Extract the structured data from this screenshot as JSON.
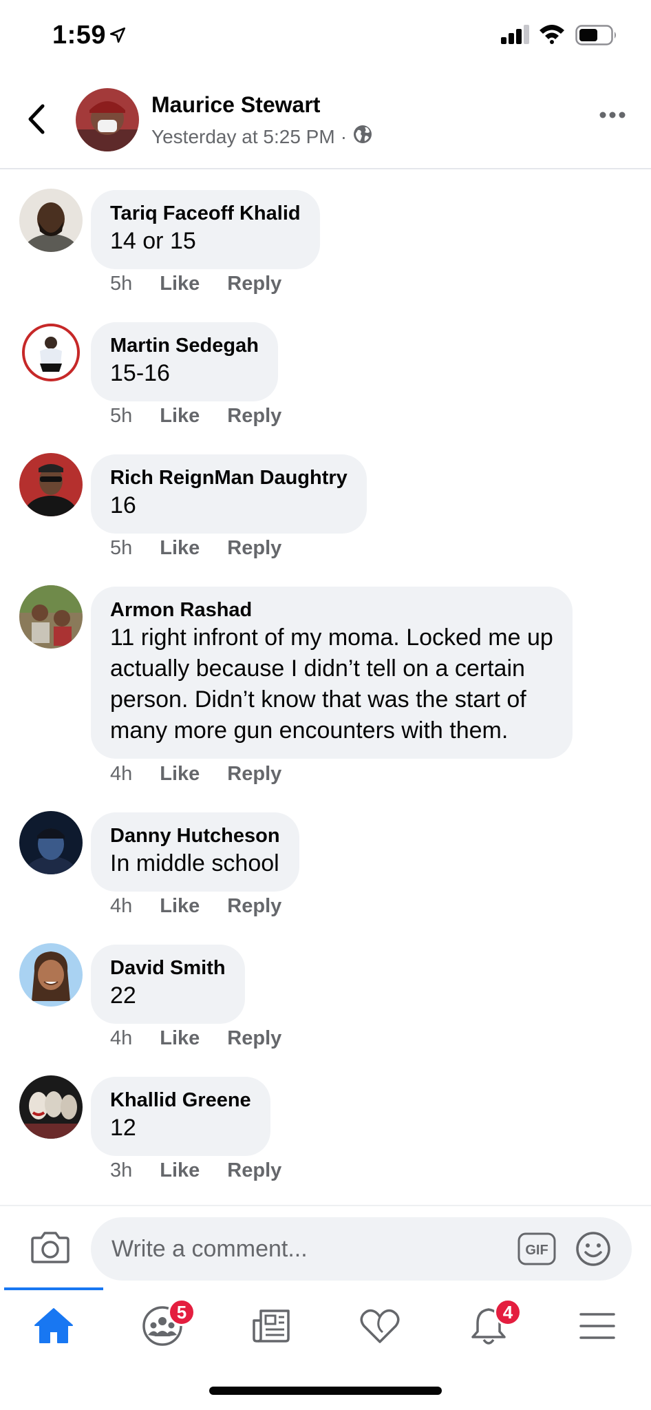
{
  "status_bar": {
    "time": "1:59"
  },
  "post": {
    "author": "Maurice Stewart",
    "timestamp": "Yesterday at 5:25 PM",
    "separator": "·"
  },
  "comments": [
    {
      "name": "Tariq Faceoff Khalid",
      "text": "14 or 15",
      "time": "5h",
      "like": "Like",
      "reply": "Reply"
    },
    {
      "name": "Martin Sedegah",
      "text": "15-16",
      "time": "5h",
      "like": "Like",
      "reply": "Reply"
    },
    {
      "name": "Rich ReignMan Daughtry",
      "text": "16",
      "time": "5h",
      "like": "Like",
      "reply": "Reply"
    },
    {
      "name": "Armon Rashad",
      "lines": [
        "11 right infront of my moma. Locked me up",
        "actually because I didn’t tell on a certain",
        "person. Didn’t know that was the start of",
        "many more gun encounters with them."
      ],
      "time": "4h",
      "like": "Like",
      "reply": "Reply"
    },
    {
      "name": "Danny Hutcheson",
      "text": "In middle school",
      "time": "4h",
      "like": "Like",
      "reply": "Reply"
    },
    {
      "name": "David Smith",
      "text": "22",
      "time": "4h",
      "like": "Like",
      "reply": "Reply"
    },
    {
      "name": "Khallid Greene",
      "text": "12",
      "time": "3h",
      "like": "Like",
      "reply": "Reply"
    }
  ],
  "composer": {
    "placeholder": "Write a comment...",
    "gif_label": "GIF"
  },
  "tabs": [
    {
      "icon": "home-icon",
      "active": true
    },
    {
      "icon": "groups-icon",
      "badge": "5"
    },
    {
      "icon": "news-icon"
    },
    {
      "icon": "dating-heart-icon"
    },
    {
      "icon": "notifications-bell-icon",
      "badge": "4"
    },
    {
      "icon": "menu-icon"
    }
  ],
  "colors": {
    "accent": "#1877f2",
    "badge": "#e41e3f",
    "bubble": "#f0f2f5",
    "secondary_text": "#65676b"
  }
}
